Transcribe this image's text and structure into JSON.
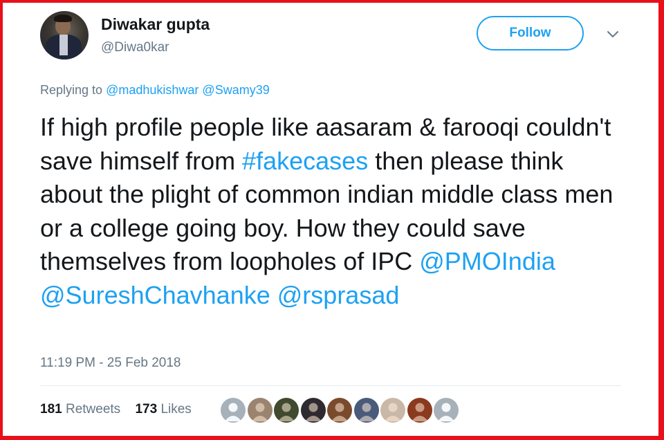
{
  "author": {
    "display_name": "Diwakar gupta",
    "handle": "@Diwa0kar",
    "avatar_icon": "user-avatar"
  },
  "follow_label": "Follow",
  "menu_icon": "chevron-down-icon",
  "reply": {
    "prefix": "Replying to",
    "mentions": [
      "@madhukishwar",
      "@Swamy39"
    ]
  },
  "tweet": {
    "text_1": "If high profile people like aasaram & farooqi couldn't save himself from ",
    "hashtag": "#fakecases",
    "text_2": " then please think about the plight of common indian middle class men or a college going boy. How they could save themselves from loopholes of IPC ",
    "mention_1": "@PMOIndia",
    "mention_2": "@SureshChavhanke",
    "mention_3": "@rsprasad"
  },
  "timestamp": "11:19 PM - 25 Feb 2018",
  "stats": {
    "retweets_count": "181",
    "retweets_label": "Retweets",
    "likes_count": "173",
    "likes_label": "Likes"
  },
  "likers": [
    {
      "name": "default-avatar-1",
      "bg": "#a7b1ba"
    },
    {
      "name": "photo-avatar-2",
      "bg": "#9a8470"
    },
    {
      "name": "photo-avatar-3",
      "bg": "#3f4a2e"
    },
    {
      "name": "photo-avatar-4",
      "bg": "#2e2a30"
    },
    {
      "name": "photo-avatar-5",
      "bg": "#7a4a2c"
    },
    {
      "name": "photo-avatar-6",
      "bg": "#4a5a7a"
    },
    {
      "name": "photo-avatar-7",
      "bg": "#c9b8a8"
    },
    {
      "name": "photo-avatar-8",
      "bg": "#8a3a1e"
    },
    {
      "name": "default-avatar-9",
      "bg": "#a7b1ba"
    }
  ],
  "colors": {
    "accent": "#1da1f2",
    "text": "#14171a",
    "muted": "#657786",
    "frame": "#e8101a"
  }
}
